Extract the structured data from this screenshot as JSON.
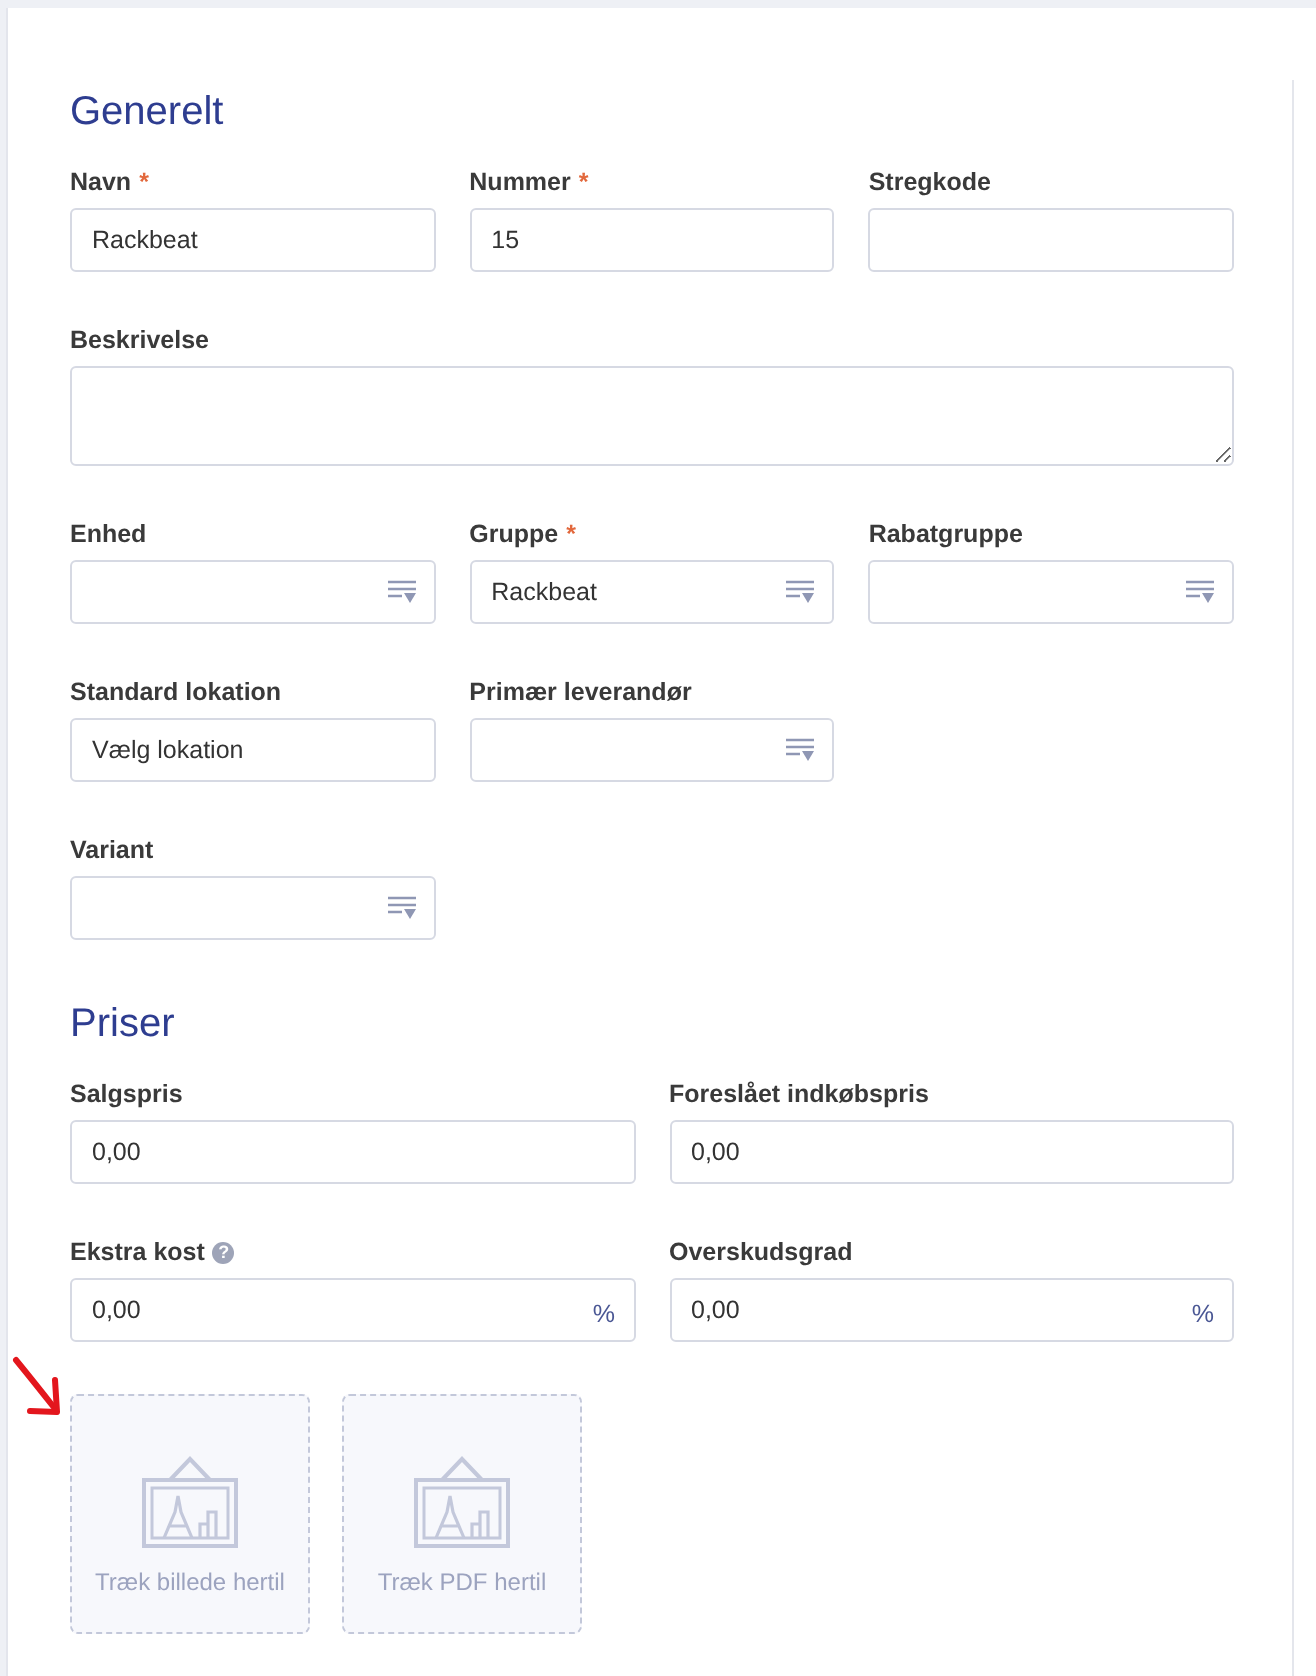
{
  "sections": [
    {
      "title": "Generelt",
      "kind": "general",
      "rows": [
        [
          {
            "label": "Navn",
            "mark": "*",
            "kind": "text",
            "value": "Rackbeat"
          },
          {
            "label": "Nummer",
            "mark": "*",
            "kind": "text",
            "value": "15"
          },
          {
            "label": "Stregkode",
            "kind": "text"
          }
        ],
        [
          {
            "label": "Beskrivelse",
            "kind": "textarea"
          }
        ],
        [
          {
            "label": "Enhed",
            "kind": "select"
          },
          {
            "label": "Gruppe",
            "mark": "*",
            "kind": "select",
            "value": "Rackbeat"
          },
          {
            "label": "Rabatgruppe",
            "kind": "select"
          }
        ],
        [
          {
            "label": "Standard lokation",
            "kind": "text",
            "value": "Vælg lokation"
          },
          {
            "label": "Primær leverandør",
            "kind": "select"
          }
        ],
        [
          {
            "label": "Variant",
            "kind": "select"
          }
        ]
      ]
    },
    {
      "title": "Priser",
      "kind": "prices",
      "rows": [
        [
          {
            "label": "Salgspris",
            "kind": "text",
            "value": "0,00"
          },
          {
            "label": "Foreslået indkøbspris",
            "kind": "text",
            "value": "0,00"
          }
        ],
        [
          {
            "label": "Ekstra kost",
            "help": "?",
            "kind": "text",
            "value": "0,00",
            "suffix": "%"
          },
          {
            "label": "Overskudsgrad",
            "kind": "text",
            "value": "0,00",
            "suffix": "%"
          }
        ]
      ]
    }
  ],
  "dropzones": [
    {
      "label": "Træk billede hertil"
    },
    {
      "label": "Træk PDF hertil"
    }
  ]
}
